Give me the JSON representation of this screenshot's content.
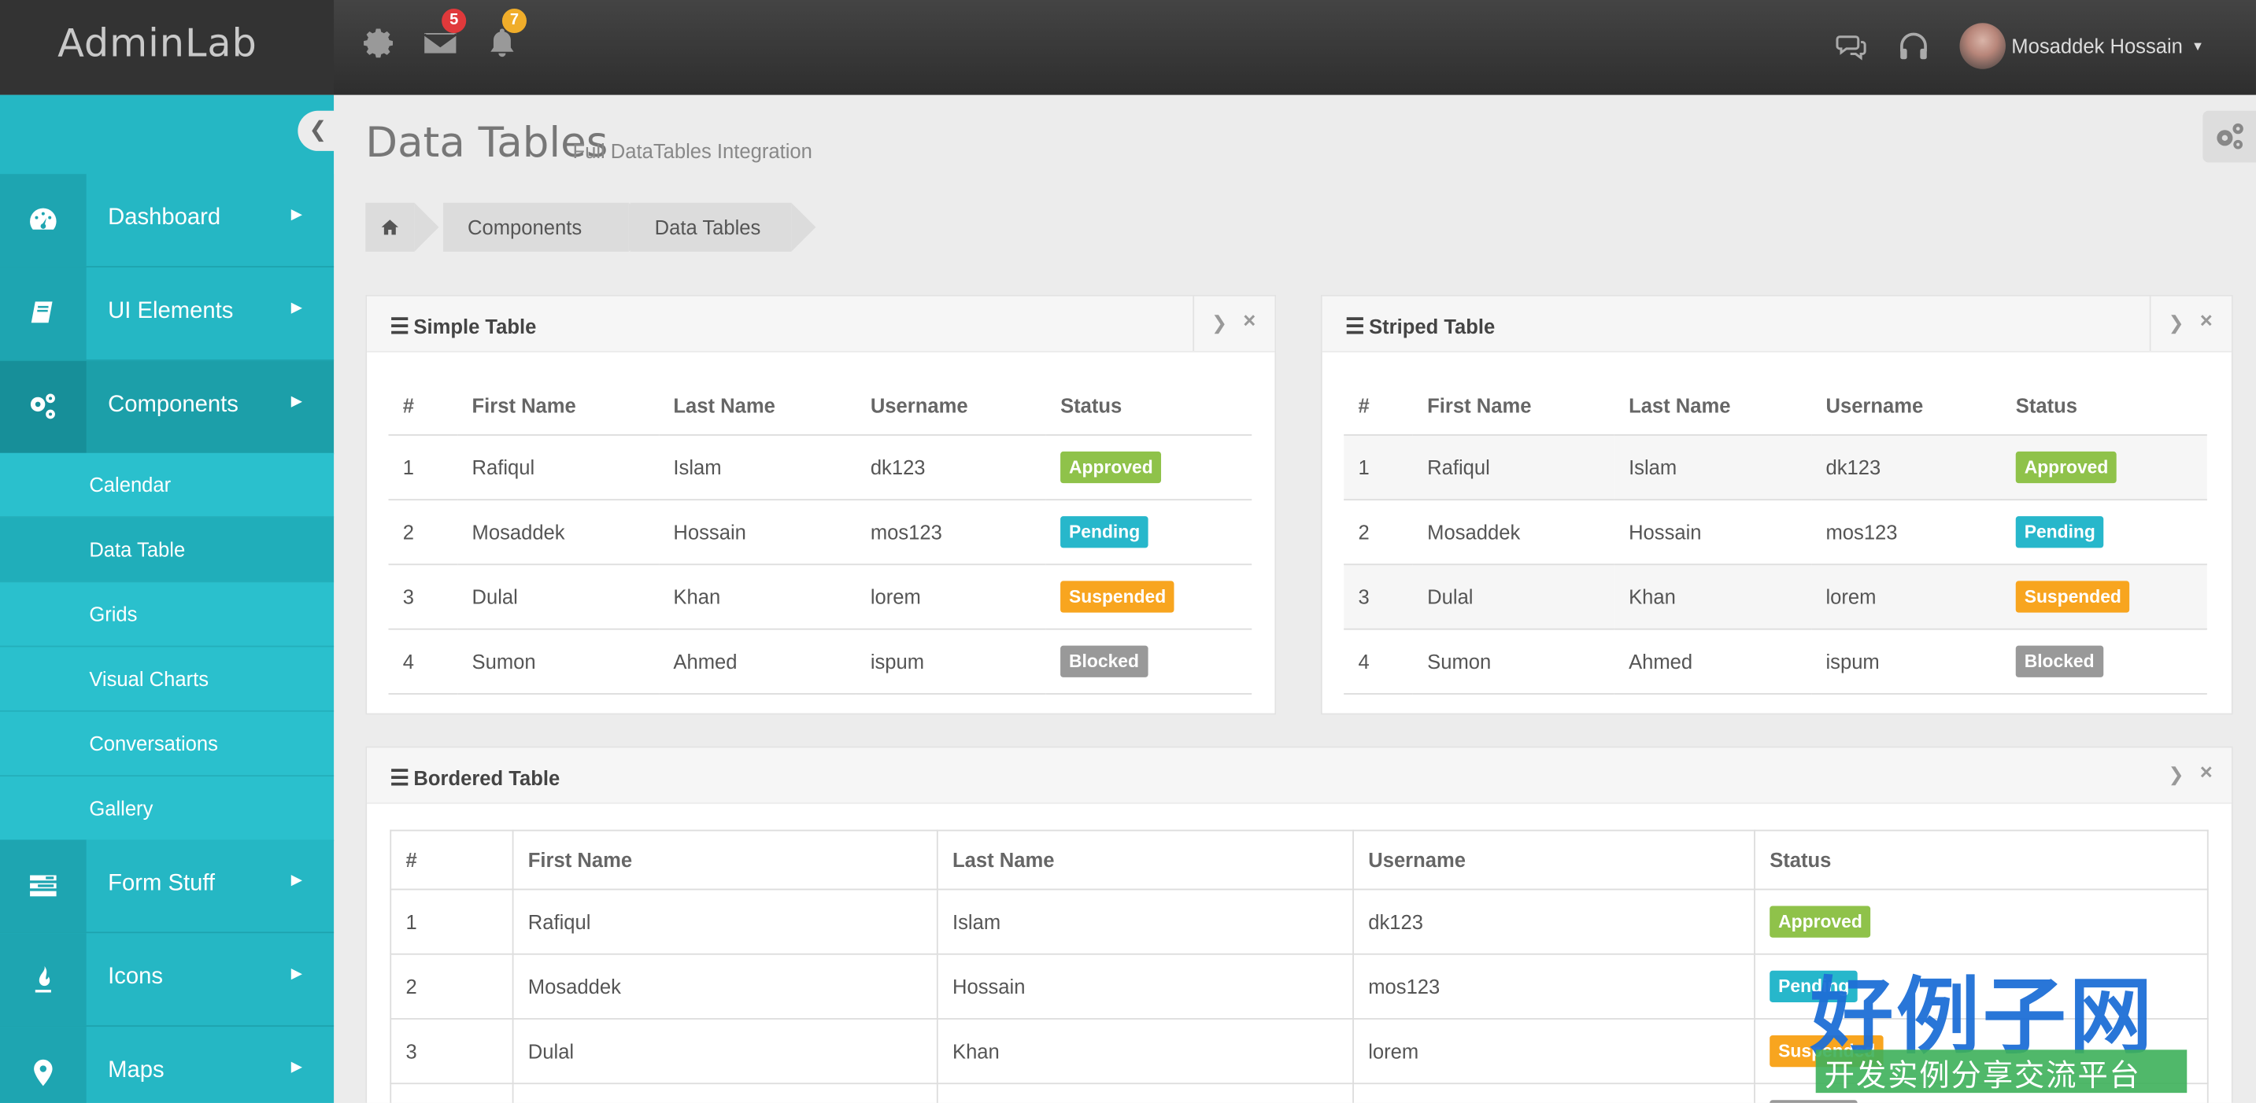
{
  "brand": "AdminLab",
  "topbar": {
    "mail_count": "5",
    "notify_count": "7",
    "user_name": "Mosaddek Hossain"
  },
  "sidebar": {
    "items": [
      {
        "label": "Dashboard",
        "icon": "dashboard-icon"
      },
      {
        "label": "UI Elements",
        "icon": "book-icon"
      },
      {
        "label": "Components",
        "icon": "cogs-icon"
      },
      {
        "label": "Form Stuff",
        "icon": "tasks-icon"
      },
      {
        "label": "Icons",
        "icon": "fire-icon"
      },
      {
        "label": "Maps",
        "icon": "map-marker-icon"
      }
    ],
    "sub_items": [
      "Calendar",
      "Data Table",
      "Grids",
      "Visual Charts",
      "Conversations",
      "Gallery"
    ]
  },
  "page": {
    "title": "Data Tables",
    "subtitle": "Full DataTables Integration"
  },
  "breadcrumb": [
    "Components",
    "Data Tables"
  ],
  "columns": [
    "#",
    "First Name",
    "Last Name",
    "Username",
    "Status"
  ],
  "rows": [
    {
      "num": "1",
      "first": "Rafiqul",
      "last": "Islam",
      "username": "dk123",
      "status": "Approved"
    },
    {
      "num": "2",
      "first": "Mosaddek",
      "last": "Hossain",
      "username": "mos123",
      "status": "Pending"
    },
    {
      "num": "3",
      "first": "Dulal",
      "last": "Khan",
      "username": "lorem",
      "status": "Suspended"
    },
    {
      "num": "4",
      "first": "Sumon",
      "last": "Ahmed",
      "username": "ispum",
      "status": "Blocked"
    }
  ],
  "status_colors": {
    "Approved": "#8fc24a",
    "Pending": "#27b7cb",
    "Suspended": "#f8a51f",
    "Blocked": "#999999"
  },
  "widgets": {
    "simple": "Simple Table",
    "striped": "Striped Table",
    "bordered": "Bordered Table"
  },
  "watermark": {
    "big": "好例子网",
    "small": "开发实例分享交流平台"
  },
  "colors": {
    "sidebar": "#25b7c4",
    "topbar": "#3a3a3a"
  }
}
